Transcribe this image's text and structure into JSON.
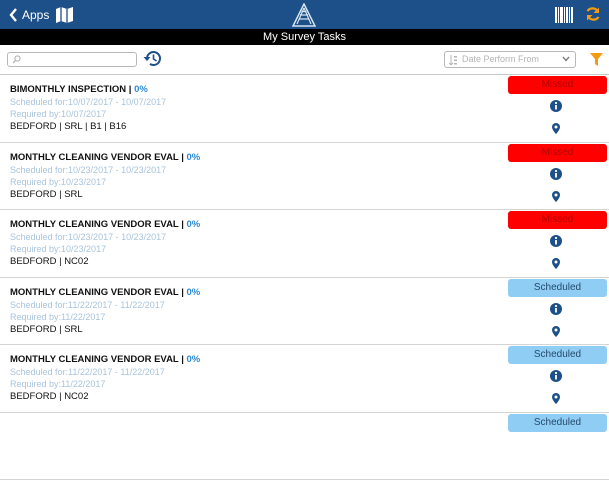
{
  "header": {
    "back_label": "Apps",
    "page_title": "My Survey Tasks"
  },
  "filters": {
    "search_placeholder": "",
    "date_filter_placeholder": "Date Perform From"
  },
  "colors": {
    "header_bg": "#1d4f88",
    "missed": "#ff0000",
    "scheduled": "#8fcdf5",
    "percent": "#2d8ad8",
    "accent_orange": "#f39c12"
  },
  "tasks": [
    {
      "title": "BIMONTHLY INSPECTION | ",
      "percent": "0%",
      "scheduled": "Scheduled for:10/07/2017 - 10/07/2017",
      "required": "Required by:10/07/2017",
      "location": "BEDFORD | SRL | B1 | B16",
      "status": "Missed"
    },
    {
      "title": "MONTHLY CLEANING VENDOR EVAL | ",
      "percent": "0%",
      "scheduled": "Scheduled for:10/23/2017 - 10/23/2017",
      "required": "Required by:10/23/2017",
      "location": "BEDFORD | SRL",
      "status": "Missed"
    },
    {
      "title": "MONTHLY CLEANING VENDOR EVAL | ",
      "percent": "0%",
      "scheduled": "Scheduled for:10/23/2017 - 10/23/2017",
      "required": "Required by:10/23/2017",
      "location": "BEDFORD | NC02",
      "status": "Missed"
    },
    {
      "title": "MONTHLY CLEANING VENDOR EVAL | ",
      "percent": "0%",
      "scheduled": "Scheduled for:11/22/2017 - 11/22/2017",
      "required": "Required by:11/22/2017",
      "location": "BEDFORD | SRL",
      "status": "Scheduled"
    },
    {
      "title": "MONTHLY CLEANING VENDOR EVAL | ",
      "percent": "0%",
      "scheduled": "Scheduled for:11/22/2017 - 11/22/2017",
      "required": "Required by:11/22/2017",
      "location": "BEDFORD | NC02",
      "status": "Scheduled"
    },
    {
      "status": "Scheduled"
    }
  ]
}
